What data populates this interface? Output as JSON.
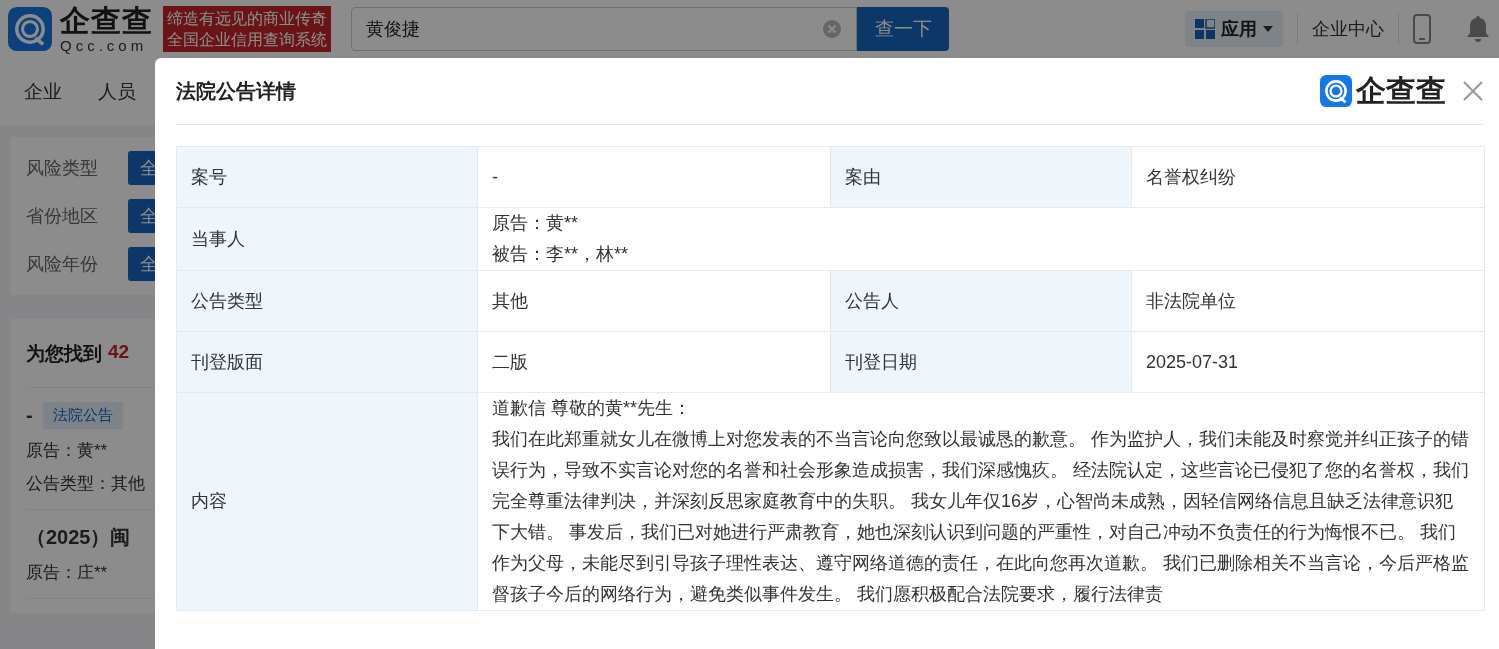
{
  "header": {
    "logo_text": "企查查",
    "logo_domain": "Qcc.com",
    "slogan": [
      "缔造有远见的商业传奇",
      "全国企业信用查询系统"
    ],
    "search": {
      "value": "黄俊捷"
    },
    "search_button": "查一下",
    "apps_menu": "应用",
    "enterprise_center": "企业中心"
  },
  "nav": [
    "企业",
    "人员"
  ],
  "filters": [
    {
      "label": "风险类型",
      "button": "全"
    },
    {
      "label": "省份地区",
      "button": "全"
    },
    {
      "label": "风险年份",
      "button": "全"
    }
  ],
  "results": {
    "prefix": "为您找到",
    "count": "42",
    "items": [
      {
        "title": "-",
        "tag": "法院公告",
        "lines": [
          "原告：黄**",
          "公告类型：其他"
        ]
      },
      {
        "title": "（2025）闽",
        "lines": [
          "原告：庄**"
        ]
      }
    ]
  },
  "modal": {
    "title": "法院公告详情",
    "brand": "企查查",
    "rows": [
      {
        "cells": [
          {
            "label": "案号",
            "value": [
              "-"
            ]
          },
          {
            "label": "案由",
            "value": [
              "名誉权纠纷"
            ]
          }
        ]
      },
      {
        "cells": [
          {
            "label": "当事人",
            "value": [
              "原告：黄**",
              "被告：李**，林**"
            ]
          }
        ]
      },
      {
        "cells": [
          {
            "label": "公告类型",
            "value": [
              "其他"
            ]
          },
          {
            "label": "公告人",
            "value": [
              "非法院单位"
            ]
          }
        ]
      },
      {
        "cells": [
          {
            "label": "刊登版面",
            "value": [
              "二版"
            ]
          },
          {
            "label": "刊登日期",
            "value": [
              "2025-07-31"
            ]
          }
        ]
      },
      {
        "cells": [
          {
            "label": "内容",
            "value": [
              "道歉信 尊敬的黄**先生：",
              "我们在此郑重就女儿在微博上对您发表的不当言论向您致以最诚恳的歉意。 作为监护人，我们未能及时察觉并纠正孩子的错误行为，导致不实言论对您的名誉和社会形象造成损害，我们深感愧疚。 经法院认定，这些言论已侵犯了您的名誉权，我们完全尊重法律判决，并深刻反思家庭教育中的失职。 我女儿年仅16岁，心智尚未成熟，因轻信网络信息且缺乏法律意识犯下大错。 事发后，我们已对她进行严肃教育，她也深刻认识到问题的严重性，对自己冲动不负责任的行为悔恨不已。 我们作为父母，未能尽到引导孩子理性表达、遵守网络道德的责任，在此向您再次道歉。 我们已删除相关不当言论，今后严格监督孩子今后的网络行为，避免类似事件发生。 我们愿积极配合法院要求，履行法律责"
            ]
          }
        ]
      }
    ]
  }
}
